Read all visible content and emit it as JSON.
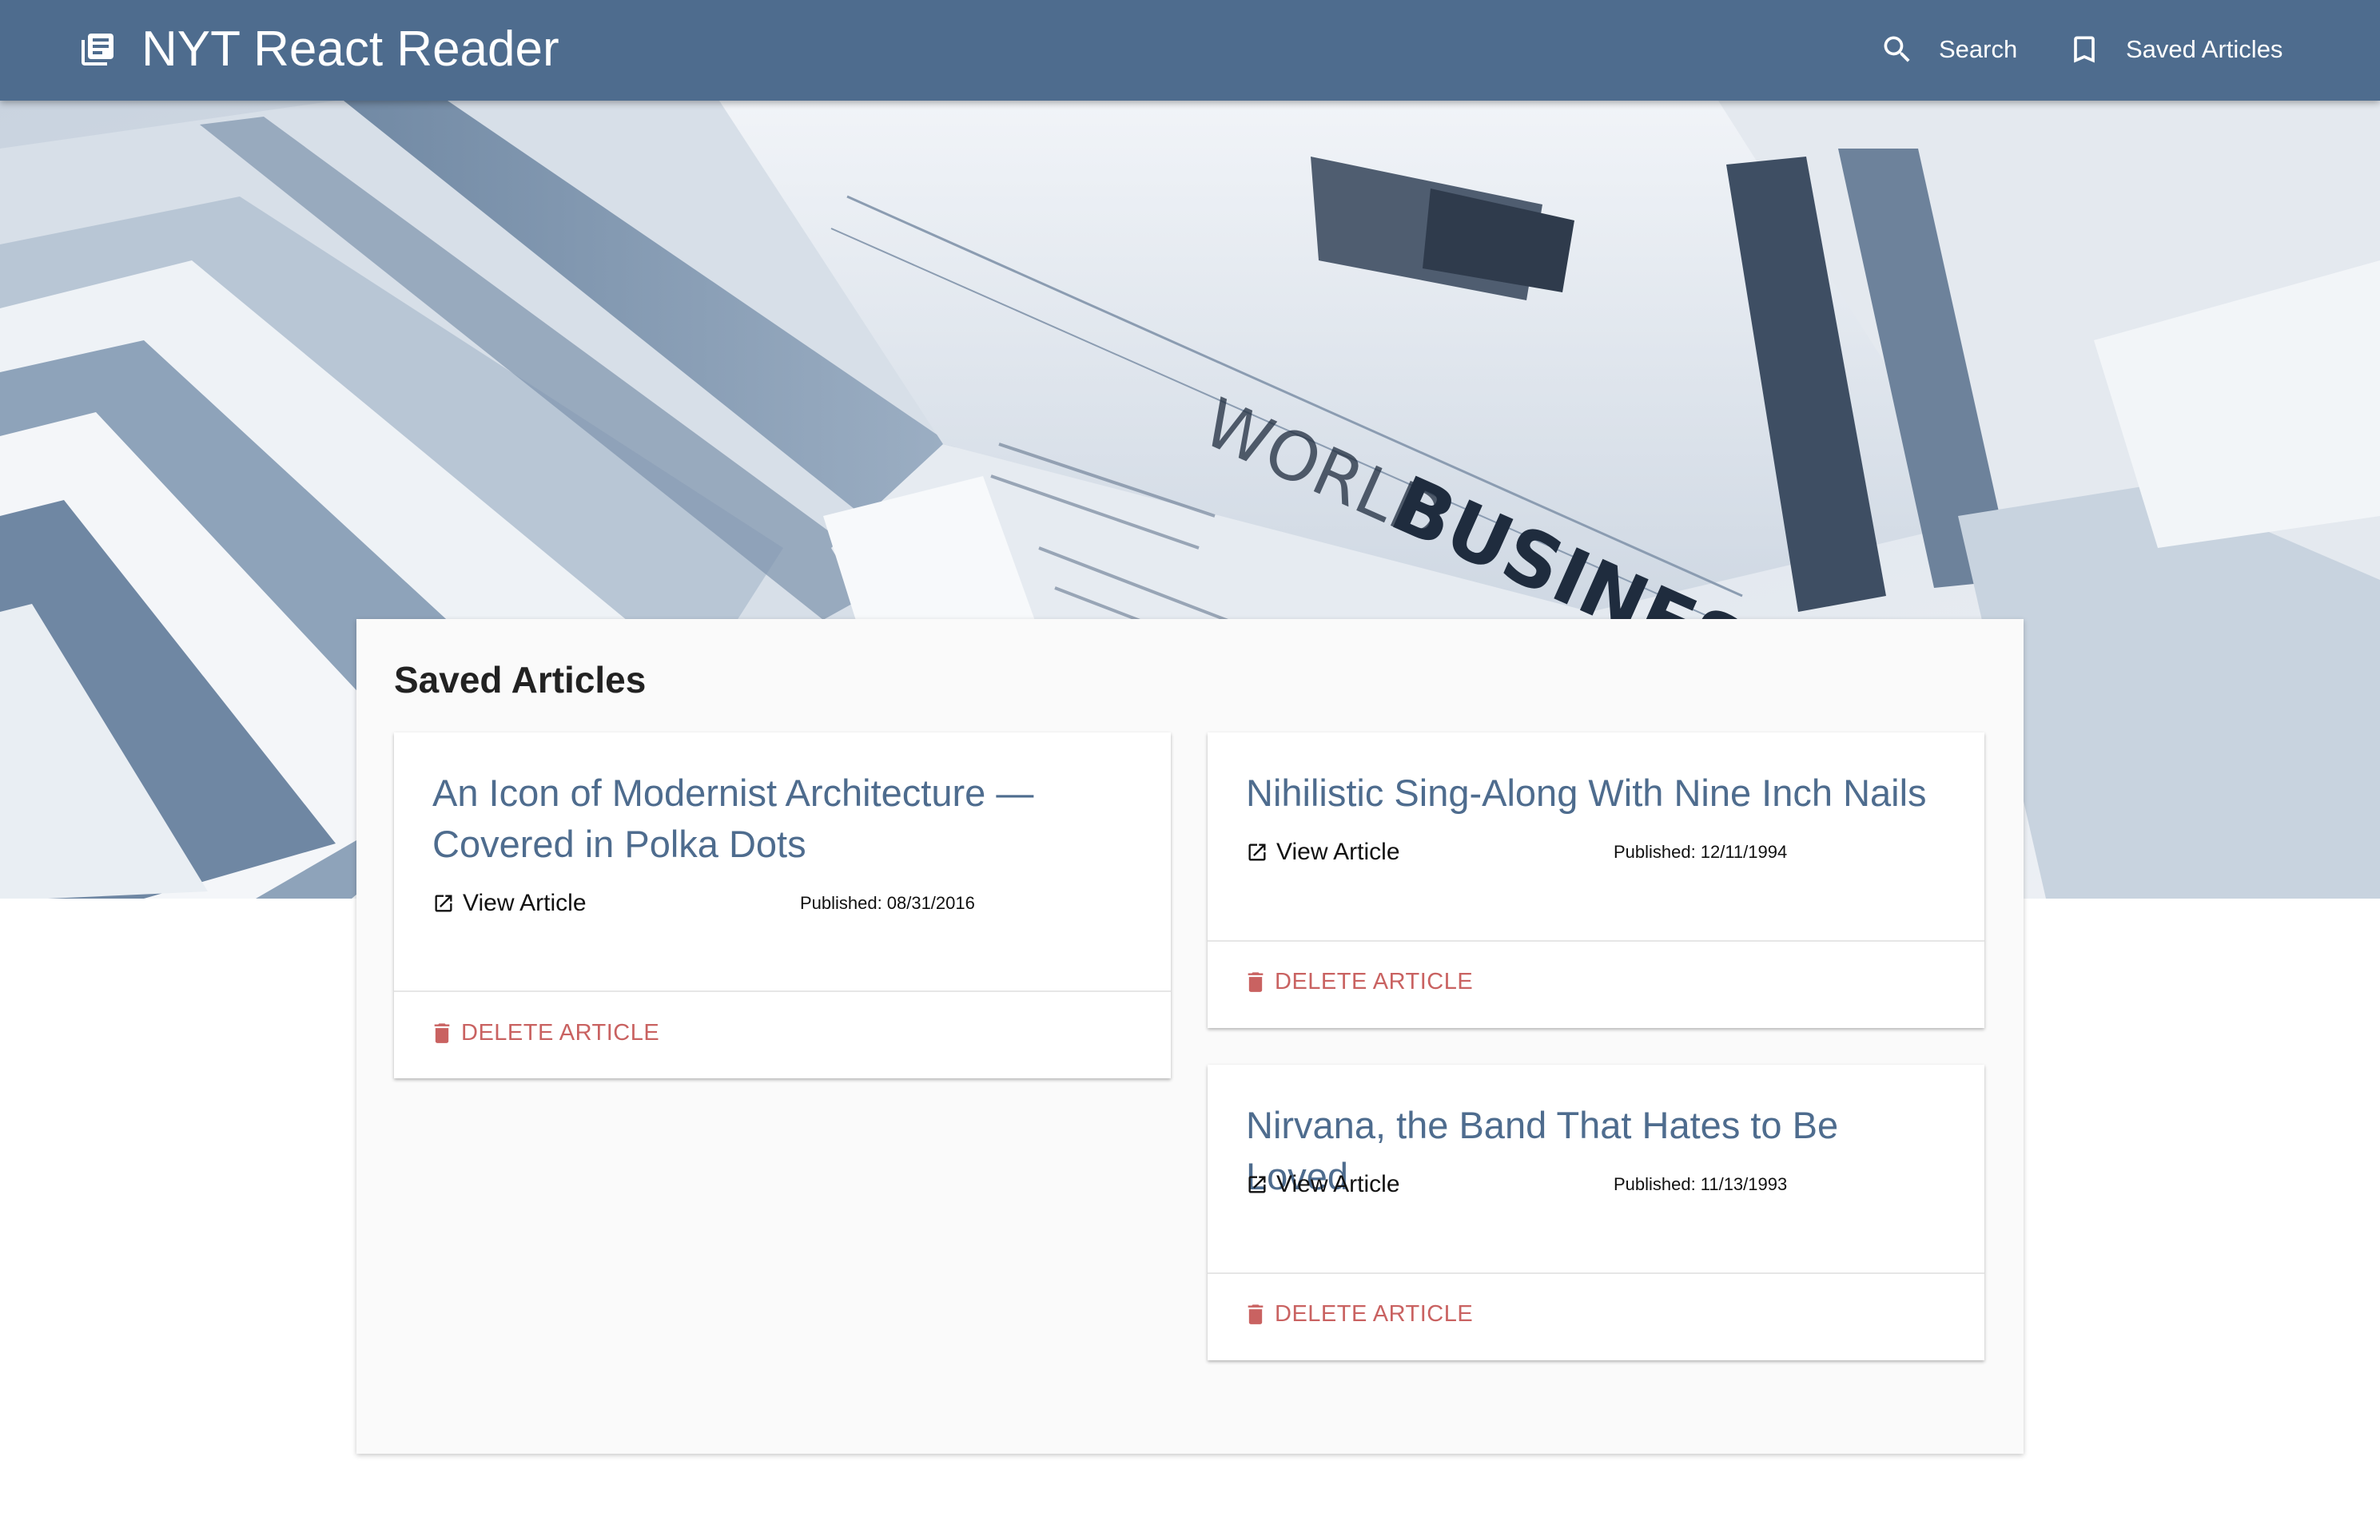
{
  "app": {
    "title": "NYT React Reader",
    "brand_icon": "library-books-icon",
    "colors": {
      "appbar": "#4e6c8e",
      "title_link": "#4e6c8e",
      "delete": "#c96261",
      "panel": "#fafafa"
    }
  },
  "nav": {
    "search_label": "Search",
    "search_icon": "search-icon",
    "saved_label": "Saved Articles",
    "saved_icon": "bookmark-icon"
  },
  "hero": {
    "word_1": "WORLD",
    "word_2": "BUSINESS"
  },
  "main": {
    "heading": "Saved Articles",
    "view_label": "View Article",
    "delete_label": "DELETE ARTICLE",
    "published_label": "Published:",
    "articles": [
      {
        "title": "An Icon of Modernist Architecture — Covered in Polka Dots",
        "published": "08/31/2016"
      },
      {
        "title": "Nihilistic Sing-Along With Nine Inch Nails",
        "published": "12/11/1994"
      },
      {
        "title": "Nirvana, the Band That Hates to Be Loved",
        "published": "11/13/1993"
      }
    ]
  }
}
